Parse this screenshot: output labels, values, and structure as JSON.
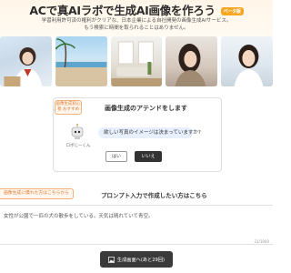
{
  "header": {
    "title": "ACで真AIラボで生成AI画像を作ろう",
    "badge": "ベータ版",
    "subtitle_line1": "学習利用許可済の権利がクリアな、日本企業による自社開発の画像生成AIサービス。",
    "subtitle_line2": "もう検索に時間を取られることはありません。"
  },
  "photos": [
    {
      "icon": "student-girl-photo"
    },
    {
      "icon": "beach-landscape-photo"
    },
    {
      "icon": "interior-room-photo"
    },
    {
      "icon": "woman-portrait-photo"
    },
    {
      "icon": "smiling-woman-photo"
    }
  ],
  "assistant": {
    "side_label": "画像生成初心者 おすすめ",
    "title": "画像生成のアテンドをします",
    "mascot_name": "ロボじーくん",
    "question": "欲しい写真のイメージは決まっていますか?",
    "yes_label": "はい",
    "no_label": "いいえ"
  },
  "prompt": {
    "side_tag": "画像生成に慣れた方はこちらから",
    "title": "プロンプト入力で作成したい方はこちら",
    "value": "女性が公園で一匹の犬の散歩をしている。天気は晴れていて青空。",
    "counter": "31/1000"
  },
  "generate_button": {
    "label": "生成画面へ(あと29回)"
  },
  "colors": {
    "accent": "#e07a2f",
    "badge": "#f5a623",
    "dark_button": "#333333",
    "bubble": "#e8f0fe"
  }
}
